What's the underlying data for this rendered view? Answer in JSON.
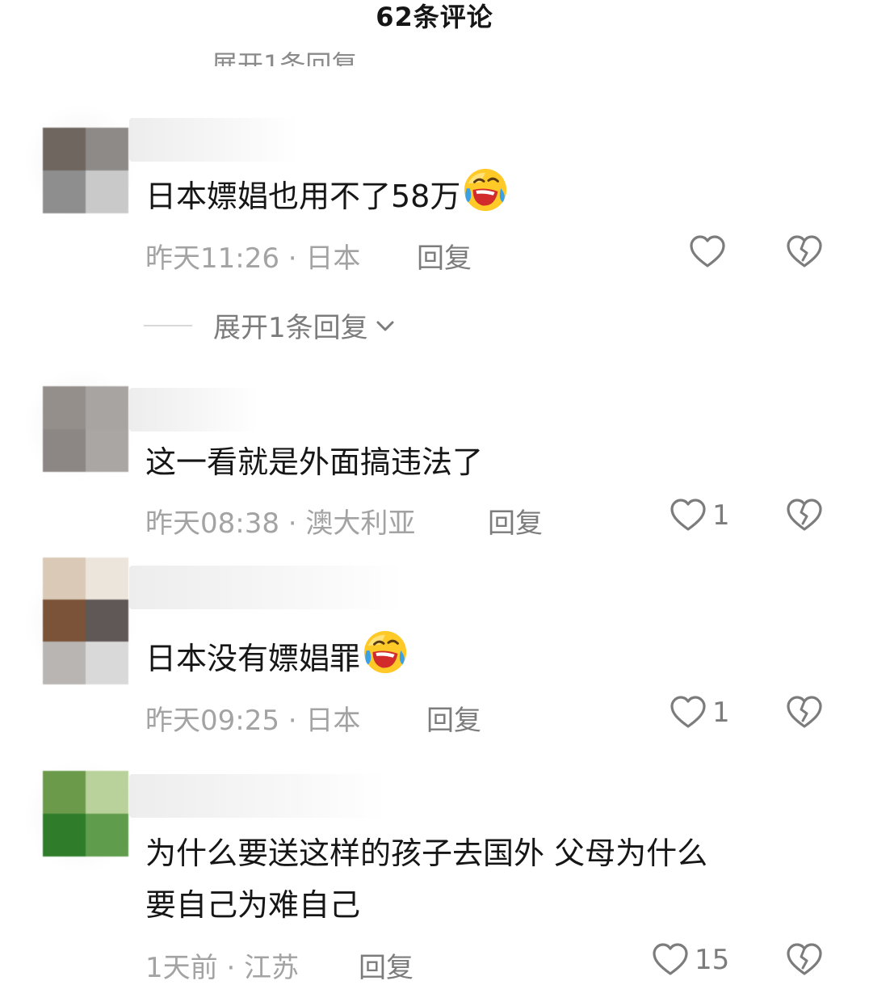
{
  "header": {
    "title": "62条评论"
  },
  "cut_reply": "展开1条回复",
  "icons": {
    "like": "heart-outline-icon",
    "dislike": "broken-heart-icon",
    "expand": "chevron-down-icon",
    "emoji": "laughing-crying-emoji"
  },
  "colors": {
    "text": "#161616",
    "meta": "#a3a3a3",
    "action": "#7c7c7c"
  },
  "comments": [
    {
      "text": "日本嫖娼也用不了58万",
      "emoji": "😂",
      "time": "昨天11:26",
      "location": "日本",
      "reply_label": "回复",
      "like_count": "",
      "expand_label": "展开1条回复"
    },
    {
      "text": "这一看就是外面搞违法了",
      "time": "昨天08:38",
      "location": "澳大利亚",
      "reply_label": "回复",
      "like_count": "1"
    },
    {
      "text": "日本没有嫖娼罪",
      "emoji": "😂",
      "time": "昨天09:25",
      "location": "日本",
      "reply_label": "回复",
      "like_count": "1"
    },
    {
      "text_line1": "为什么要送这样的孩子去国外   父母为什么",
      "text_line2": "要自己为难自己",
      "time": "1天前",
      "location": "江苏",
      "reply_label": "回复",
      "like_count": "15"
    }
  ],
  "separator": " · "
}
